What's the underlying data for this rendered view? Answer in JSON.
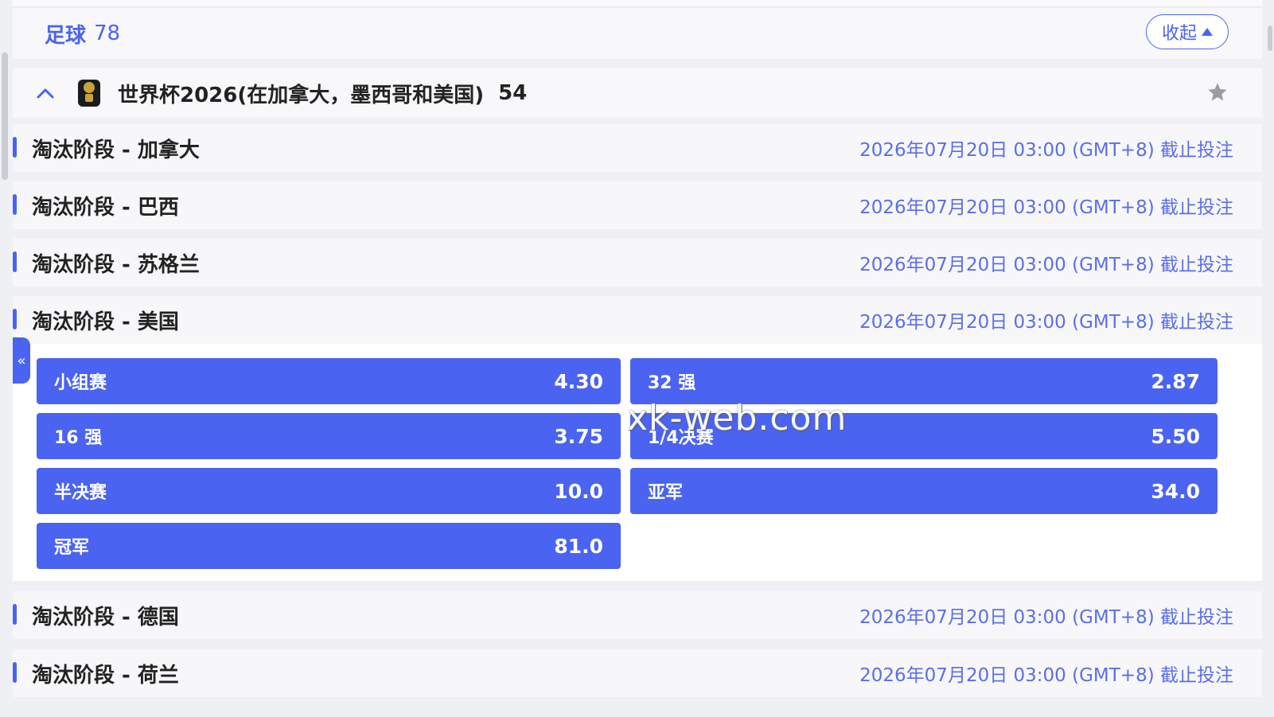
{
  "sport": {
    "title": "足球",
    "count": "78",
    "collapse_label": "收起"
  },
  "league": {
    "name": "世界杯2026(在加拿大，墨西哥和美国)",
    "count": "54"
  },
  "markets": [
    {
      "name": "淘汰阶段 - 加拿大",
      "deadline": "2026年07月20日 03:00 (GMT+8) 截止投注"
    },
    {
      "name": "淘汰阶段 - 巴西",
      "deadline": "2026年07月20日 03:00 (GMT+8) 截止投注"
    },
    {
      "name": "淘汰阶段 - 苏格兰",
      "deadline": "2026年07月20日 03:00 (GMT+8) 截止投注"
    },
    {
      "name": "淘汰阶段 - 美国",
      "deadline": "2026年07月20日 03:00 (GMT+8) 截止投注"
    },
    {
      "name": "淘汰阶段 - 德国",
      "deadline": "2026年07月20日 03:00 (GMT+8) 截止投注"
    },
    {
      "name": "淘汰阶段 - 荷兰",
      "deadline": "2026年07月20日 03:00 (GMT+8) 截止投注"
    }
  ],
  "odds": [
    {
      "label": "小组赛",
      "price": "4.30"
    },
    {
      "label": "32 强",
      "price": "2.87"
    },
    {
      "label": "16 强",
      "price": "3.75"
    },
    {
      "label": "1/4决赛",
      "price": "5.50"
    },
    {
      "label": "半决赛",
      "price": "10.0"
    },
    {
      "label": "亚军",
      "price": "34.0"
    },
    {
      "label": "冠军",
      "price": "81.0"
    }
  ],
  "side_tab_label": "«",
  "watermark": "xk-web.com",
  "colors": {
    "accent": "#4a63f0",
    "deadline_text": "#5a6ee8"
  }
}
